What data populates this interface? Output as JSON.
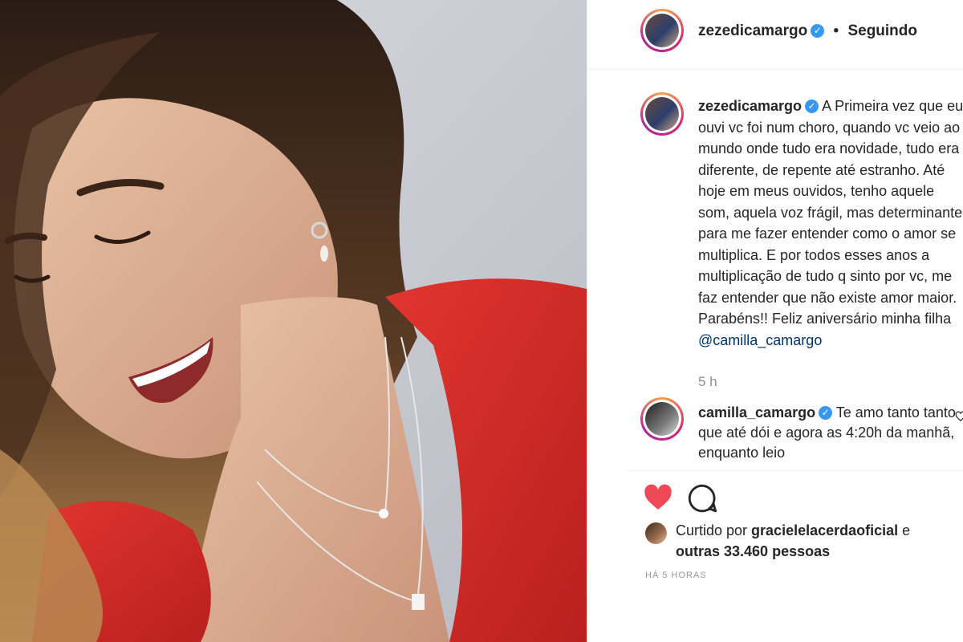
{
  "post": {
    "username": "zezedicamargo",
    "follow_separator": "•",
    "follow_state": "Seguindo",
    "verified_glyph": "✓"
  },
  "caption": {
    "username": "zezedicamargo",
    "text": "A Primeira vez que eu ouvi vc foi num choro, quando vc veio ao mundo onde tudo era novidade, tudo era diferente, de repente até estranho. Até hoje em meus ouvidos, tenho aquele som, aquela voz frágil, mas determinante para me fazer entender como o amor se multiplica. E por todos esses anos a multiplicação de tudo q sinto por vc, me faz entender que não existe amor maior. Parabéns!! Feliz aniversário minha filha ",
    "mention": "@camilla_camargo",
    "time": "5 h"
  },
  "comment": {
    "username": "camilla_camargo",
    "text": "Te amo tanto tanto que até dói e agora as 4:20h da manhã, enquanto leio"
  },
  "likes": {
    "prefix": "Curtido por ",
    "liker": "gracielelacerdaoficial",
    "middle": " e",
    "others": "outras 33.460 pessoas"
  },
  "timestamp": "HÁ 5 HORAS",
  "icons": {
    "like": "heart-filled-icon",
    "comment": "comment-bubble-icon",
    "comment_like": "heart-outline-icon"
  },
  "colors": {
    "heart": "#ed4956",
    "verified": "#3897f0",
    "mention": "#003569",
    "muted": "#8e8e8e"
  }
}
